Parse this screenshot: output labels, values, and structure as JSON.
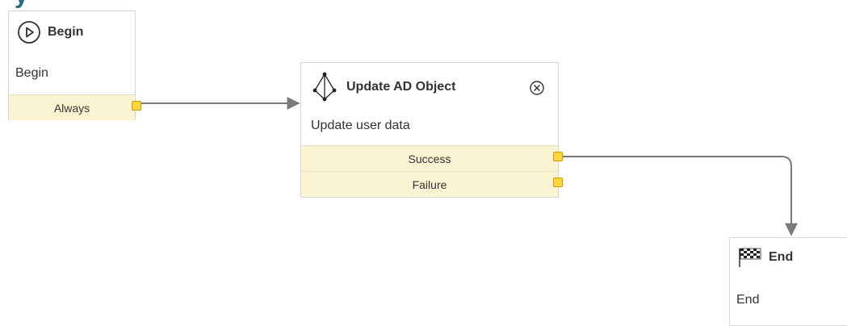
{
  "colors": {
    "port_bg": "#fbf4d3",
    "port_handle": "#ffd53a",
    "connector": "#7a7a7a",
    "title_accent": "#2a6a84"
  },
  "header": {
    "partial_title": "y"
  },
  "nodes": {
    "begin": {
      "title": "Begin",
      "description": "Begin",
      "icon": "play-circle-icon",
      "ports": [
        {
          "label": "Always"
        }
      ]
    },
    "update_ad_object": {
      "title": "Update AD Object",
      "description": "Update user data",
      "icon": "ad-object-icon",
      "close_icon": "close-circle-icon",
      "ports": [
        {
          "label": "Success"
        },
        {
          "label": "Failure"
        }
      ]
    },
    "end": {
      "title": "End",
      "description": "End",
      "icon": "checkered-flag-icon"
    }
  }
}
